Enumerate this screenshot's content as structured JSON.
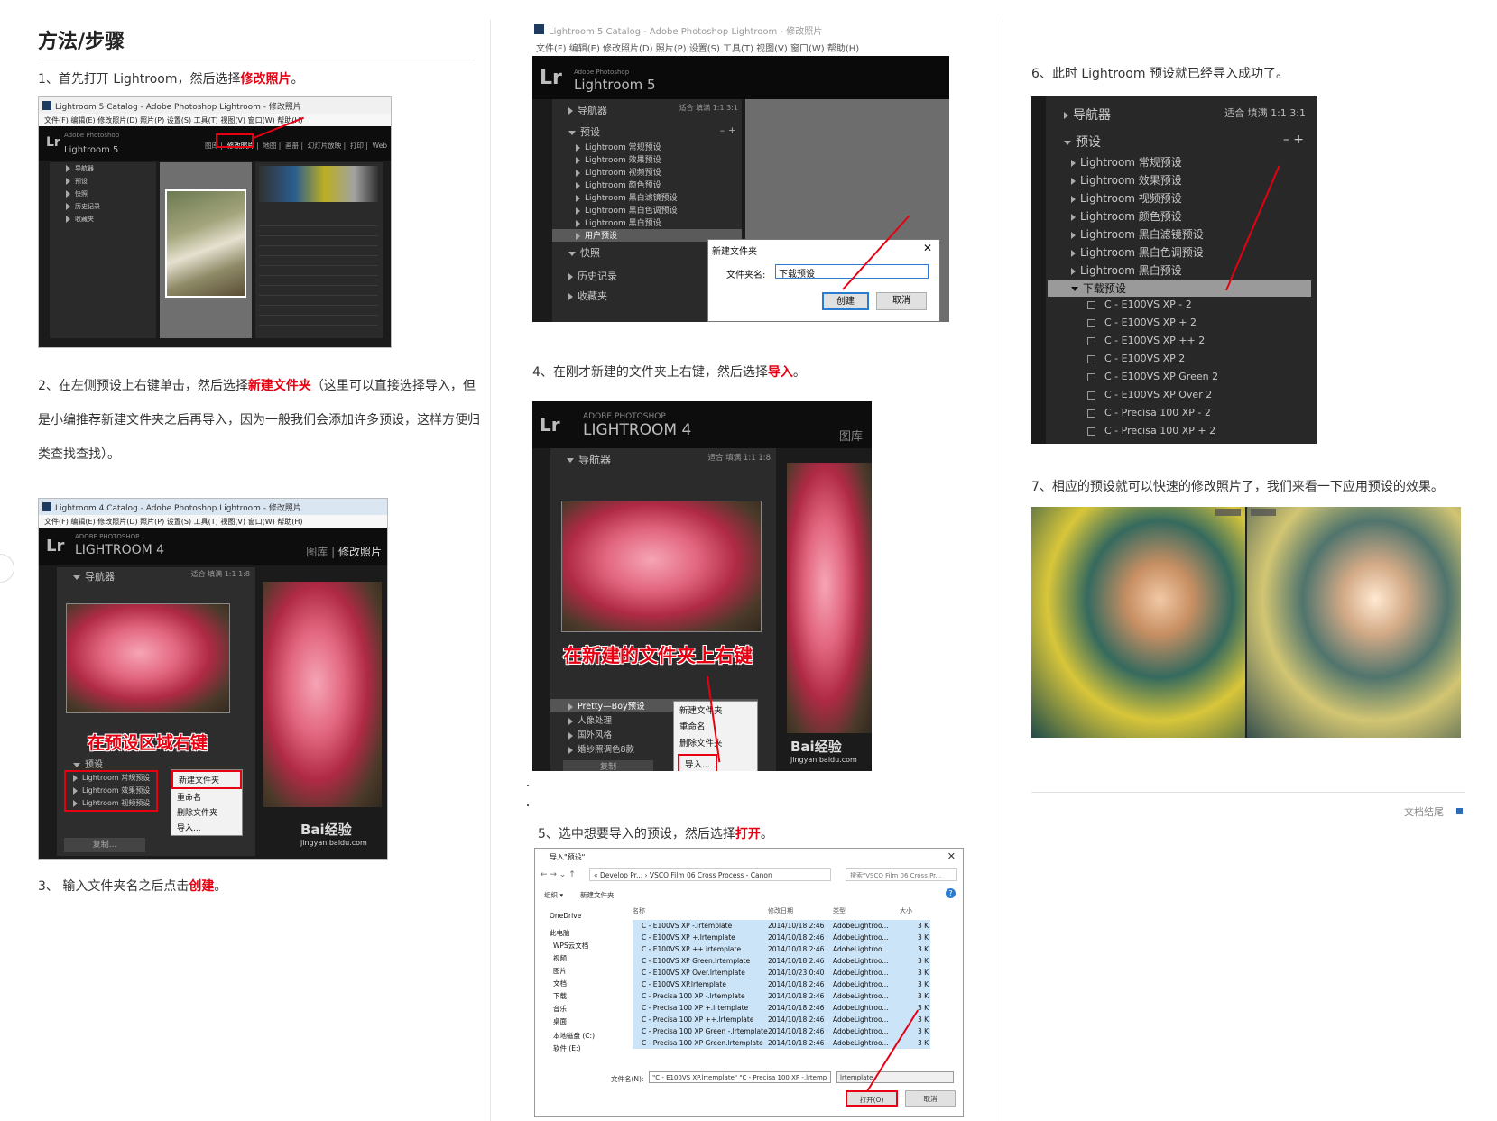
{
  "heading": "方法/步骤",
  "steps": {
    "s1": {
      "prefix": "1、首先打开 Lightroom，然后选择",
      "highlight": "修改照片",
      "suffix": "。"
    },
    "s2": {
      "prefix": "2、在左侧预设上右键单击，然后选择",
      "highlight": "新建文件夹",
      "line1_rest": "（这里可以直接选择导入，但",
      "line2": "是小编推荐新建文件夹之后再导入，因为一般我们会添加许多预设，这样方便归",
      "line3": "类查找查找）。"
    },
    "s3": {
      "prefix": "3、 输入文件夹名之后点击",
      "highlight": "创建",
      "suffix": "。"
    },
    "s4": {
      "prefix": "4、在刚才新建的文件夹上右键，然后选择",
      "highlight": "导入",
      "suffix": "。"
    },
    "s5": {
      "prefix": "5、选中想要导入的预设，然后选择",
      "highlight": "打开",
      "suffix": "。"
    },
    "s6": {
      "text": "6、此时 Lightroom 预设就已经导入成功了。"
    },
    "s7": {
      "text": "7、相应的预设就可以快速的修改照片了，我们来看一下应用预设的效果。"
    }
  },
  "shot1": {
    "title": "Lightroom 5 Catalog - Adobe Photoshop Lightroom - 修改照片",
    "menu": "文件(F)  编辑(E)  修改照片(D)  照片(P)  设置(S)  工具(T)  视图(V)  窗口(W)  帮助(H)",
    "product": "Lightroom 5",
    "adobe": "Adobe Photoshop",
    "modules": [
      "图库",
      "修改照片",
      "地图",
      "画册",
      "幻灯片放映",
      "打印",
      "Web"
    ],
    "left_panels": [
      "导航器",
      "预设",
      "快照",
      "历史记录",
      "收藏夹"
    ]
  },
  "shot2": {
    "title": "Lightroom 4 Catalog - Adobe Photoshop Lightroom - 修改照片",
    "menu": "文件(F)  编辑(E)  修改照片(D)  照片(P)  设置(S)  工具(T)  视图(V)  窗口(W)  帮助(H)",
    "adobe": "ADOBE PHOTOSHOP",
    "product": "LIGHTROOM 4",
    "modules": [
      "图库",
      "修改照片"
    ],
    "navigator": "导航器",
    "nav_opts": "适合  填满  1:1  1:8",
    "overlay": "在预设区域右键",
    "presets_label": "预设",
    "presets": [
      "Lightroom 常规预设",
      "Lightroom 效果预设",
      "Lightroom 视频预设"
    ],
    "menu_items": [
      "新建文件夹",
      "重命名",
      "删除文件夹",
      "导入..."
    ],
    "copy_btn": "复制...",
    "watermark": "Bai经验",
    "watermark_url": "jingyan.baidu.com"
  },
  "shot3": {
    "title": "Lightroom 5 Catalog - Adobe Photoshop Lightroom - 修改照片",
    "menu": "文件(F)  编辑(E)  修改照片(D)  照片(P)  设置(S)  工具(T)  视图(V)  窗口(W)  帮助(H)",
    "adobe": "Adobe Photoshop",
    "product": "Lightroom 5",
    "navigator": "导航器",
    "nav_opts": "适合  填满  1:1  3:1",
    "presets_label": "预设",
    "presets": [
      "Lightroom 常规预设",
      "Lightroom 效果预设",
      "Lightroom 视频预设",
      "Lightroom 颜色预设",
      "Lightroom 黑白滤镜预设",
      "Lightroom 黑白色调预设",
      "Lightroom 黑白预设",
      "用户预设"
    ],
    "lower_panels": [
      "快照",
      "历史记录",
      "收藏夹"
    ],
    "dialog_title": "新建文件夹",
    "dialog_label": "文件夹名:",
    "dialog_value": "下载预设",
    "create": "创建",
    "cancel": "取消"
  },
  "shot4": {
    "adobe": "ADOBE PHOTOSHOP",
    "product": "LIGHTROOM 4",
    "module": "图库",
    "navigator": "导航器",
    "nav_opts": "适合  填满  1:1  1:8",
    "overlay": "在新建的文件夹上右键",
    "presets": [
      "Pretty—Boy预设",
      "人像处理",
      "国外风格",
      "婚纱照调色8款"
    ],
    "menu_items": [
      "新建文件夹",
      "重命名",
      "删除文件夹",
      "导入..."
    ],
    "copy_btn": "复制",
    "watermark": "Bai经验",
    "watermark_url": "jingyan.baidu.com"
  },
  "shot5": {
    "title": "导入\"预设\"",
    "path": "« Develop Pr...  ›  VSCO Film 06 Cross Process - Canon",
    "search": "搜索\"VSCO Film 06 Cross Pr...",
    "toolbar": [
      "组织 ▾",
      "新建文件夹"
    ],
    "columns": [
      "名称",
      "修改日期",
      "类型",
      "大小"
    ],
    "sidebar": [
      "OneDrive",
      "此电脑",
      "WPS云文档",
      "视频",
      "图片",
      "文档",
      "下载",
      "音乐",
      "桌面",
      "本地磁盘 (C:)",
      "软件 (E:)"
    ],
    "files": [
      [
        "C - E100VS XP -.lrtemplate",
        "2014/10/18 2:46",
        "AdobeLightroo...",
        "3 K"
      ],
      [
        "C - E100VS XP +.lrtemplate",
        "2014/10/18 2:46",
        "AdobeLightroo...",
        "3 K"
      ],
      [
        "C - E100VS XP ++.lrtemplate",
        "2014/10/18 2:46",
        "AdobeLightroo...",
        "3 K"
      ],
      [
        "C - E100VS XP Green.lrtemplate",
        "2014/10/18 2:46",
        "AdobeLightroo...",
        "3 K"
      ],
      [
        "C - E100VS XP Over.lrtemplate",
        "2014/10/23 0:40",
        "AdobeLightroo...",
        "3 K"
      ],
      [
        "C - E100VS XP.lrtemplate",
        "2014/10/18 2:46",
        "AdobeLightroo...",
        "3 K"
      ],
      [
        "C - Precisa 100 XP -.lrtemplate",
        "2014/10/18 2:46",
        "AdobeLightroo...",
        "3 K"
      ],
      [
        "C - Precisa 100 XP +.lrtemplate",
        "2014/10/18 2:46",
        "AdobeLightroo...",
        "3 K"
      ],
      [
        "C - Precisa 100 XP ++.lrtemplate",
        "2014/10/18 2:46",
        "AdobeLightroo...",
        "3 K"
      ],
      [
        "C - Precisa 100 XP Green -.lrtemplate",
        "2014/10/18 2:46",
        "AdobeLightroo...",
        "3 K"
      ],
      [
        "C - Precisa 100 XP Green.lrtemplate",
        "2014/10/18 2:46",
        "AdobeLightroo...",
        "3 K"
      ]
    ],
    "filename_label": "文件名(N):",
    "filename_value": "\"C - E100VS XP.lrtemplate\" \"C - Precisa 100 XP -.lrtemp",
    "filetype": "lrtemplate",
    "open": "打开(O)",
    "cancel": "取消"
  },
  "shot6": {
    "navigator": "导航器",
    "nav_opts": "适合  填满  1:1  3:1",
    "presets_label": "预设",
    "presets": [
      "Lightroom 常规预设",
      "Lightroom 效果预设",
      "Lightroom 视频预设",
      "Lightroom 颜色预设",
      "Lightroom 黑白滤镜预设",
      "Lightroom 黑白色调预设",
      "Lightroom 黑白预设"
    ],
    "folder": "下载预设",
    "items": [
      "C - E100VS XP - 2",
      "C - E100VS XP + 2",
      "C - E100VS XP ++ 2",
      "C - E100VS XP 2",
      "C - E100VS XP Green 2",
      "C - E100VS XP Over 2",
      "C - Precisa 100 XP - 2",
      "C - Precisa 100 XP + 2"
    ]
  },
  "end_label": "文档结尾",
  "colors": {
    "highlight": "#e60012",
    "lr_dark": "#1b1b1b",
    "selection": "#cce4f7"
  }
}
